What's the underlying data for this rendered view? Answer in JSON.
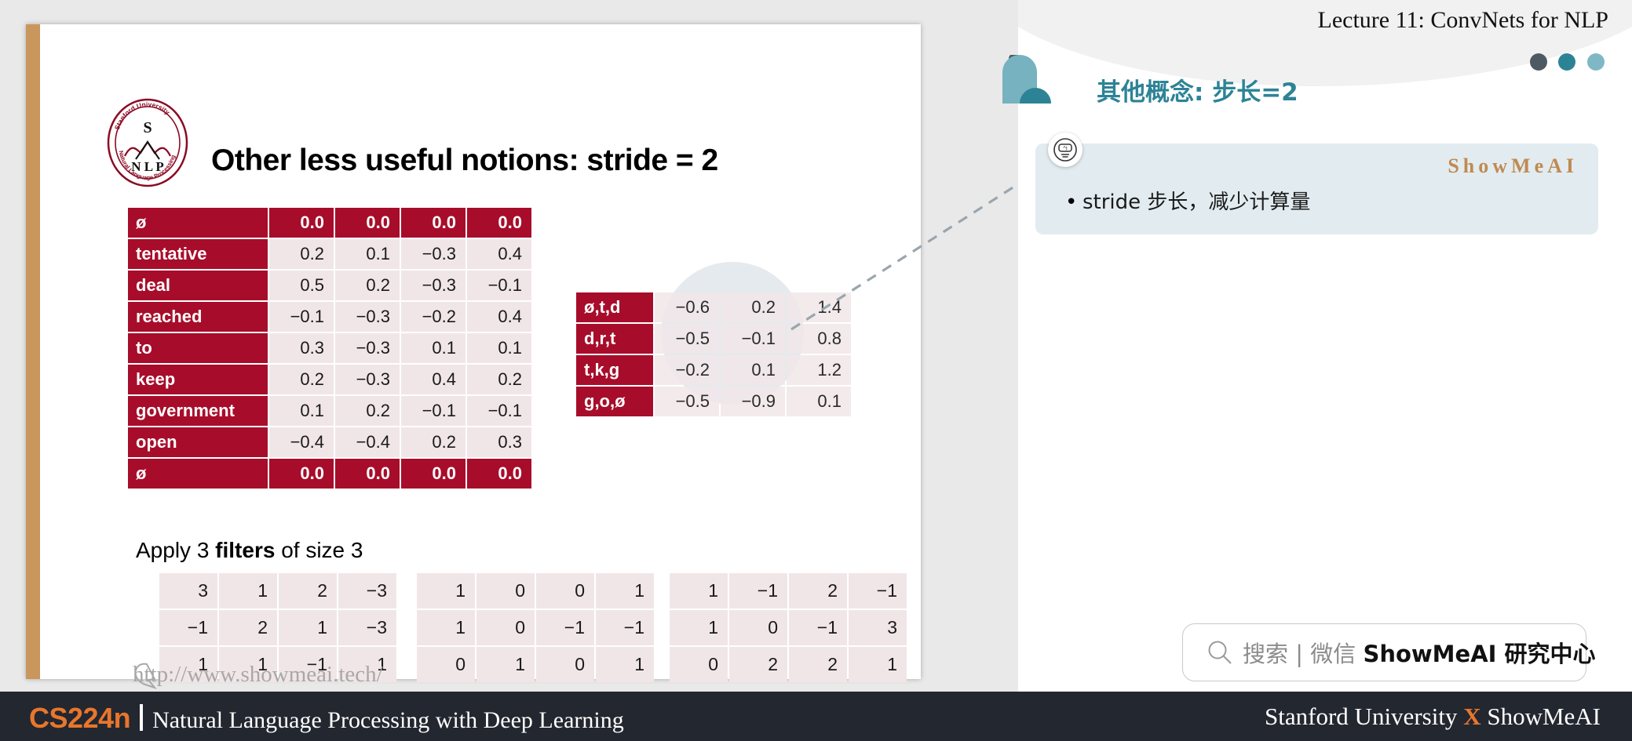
{
  "header": {
    "lecture_title": "Lecture 11: ConvNets for NLP",
    "section_title": "其他概念: 步长=2",
    "dots": [
      "dot-dark",
      "dot-teal",
      "dot-light-teal"
    ]
  },
  "note_box": {
    "brand": "ShowMeAI",
    "bullet_marker": "•",
    "bullet_text": "stride 步长，减少计算量",
    "badge_icon": "ai-badge-icon"
  },
  "slide": {
    "title": "Other less useful notions: stride = 2",
    "logo_alt": "stanford-nlp-logo",
    "logo_lines": [
      "Stanford University",
      "S",
      "N L P",
      "Natural Language Processing"
    ],
    "apply_caption_pre": "Apply 3 ",
    "apply_caption_bold": "filters",
    "apply_caption_post": " of size 3",
    "watermark": "http://www.showmeai.tech/"
  },
  "main_table": {
    "rows": [
      {
        "label": "ø",
        "pad": true,
        "values": [
          "0.0",
          "0.0",
          "0.0",
          "0.0"
        ]
      },
      {
        "label": "tentative",
        "pad": false,
        "values": [
          "0.2",
          "0.1",
          "−0.3",
          "0.4"
        ]
      },
      {
        "label": "deal",
        "pad": false,
        "values": [
          "0.5",
          "0.2",
          "−0.3",
          "−0.1"
        ]
      },
      {
        "label": "reached",
        "pad": false,
        "values": [
          "−0.1",
          "−0.3",
          "−0.2",
          "0.4"
        ]
      },
      {
        "label": "to",
        "pad": false,
        "values": [
          "0.3",
          "−0.3",
          "0.1",
          "0.1"
        ]
      },
      {
        "label": "keep",
        "pad": false,
        "values": [
          "0.2",
          "−0.3",
          "0.4",
          "0.2"
        ]
      },
      {
        "label": "government",
        "pad": false,
        "values": [
          "0.1",
          "0.2",
          "−0.1",
          "−0.1"
        ]
      },
      {
        "label": "open",
        "pad": false,
        "values": [
          "−0.4",
          "−0.4",
          "0.2",
          "0.3"
        ]
      },
      {
        "label": "ø",
        "pad": true,
        "values": [
          "0.0",
          "0.0",
          "0.0",
          "0.0"
        ]
      }
    ]
  },
  "output_table": {
    "rows": [
      {
        "label": "ø,t,d",
        "values": [
          "−0.6",
          "0.2",
          "1.4"
        ]
      },
      {
        "label": "d,r,t",
        "values": [
          "−0.5",
          "−0.1",
          "0.8"
        ]
      },
      {
        "label": "t,k,g",
        "values": [
          "−0.2",
          "0.1",
          "1.2"
        ]
      },
      {
        "label": "g,o,ø",
        "values": [
          "−0.5",
          "−0.9",
          "0.1"
        ]
      }
    ]
  },
  "filters": [
    {
      "name": "filter-1",
      "rows": [
        [
          "3",
          "1",
          "2",
          "−3"
        ],
        [
          "−1",
          "2",
          "1",
          "−3"
        ],
        [
          "1",
          "1",
          "−1",
          "1"
        ]
      ]
    },
    {
      "name": "filter-2",
      "rows": [
        [
          "1",
          "0",
          "0",
          "1"
        ],
        [
          "1",
          "0",
          "−1",
          "−1"
        ],
        [
          "0",
          "1",
          "0",
          "1"
        ]
      ]
    },
    {
      "name": "filter-3",
      "rows": [
        [
          "1",
          "−1",
          "2",
          "−1"
        ],
        [
          "1",
          "0",
          "−1",
          "3"
        ],
        [
          "0",
          "2",
          "2",
          "1"
        ]
      ]
    }
  ],
  "search": {
    "icon": "search-icon",
    "muted_text": "搜索 | 微信 ",
    "bold_text": "ShowMeAI 研究中心"
  },
  "footer": {
    "course_code": "CS224n",
    "course_name": "Natural Language Processing with Deep Learning",
    "right_pre": "Stanford University ",
    "right_x": "X",
    "right_post": " ShowMeAI"
  },
  "colors": {
    "crimson": "#a70d2a",
    "cell_pink": "#f1e6e7",
    "teal": "#2d8396",
    "orange": "#e8762c",
    "footer_bg": "#232730",
    "note_bg": "#e2ecf0",
    "brand_tan": "#c08a52"
  }
}
